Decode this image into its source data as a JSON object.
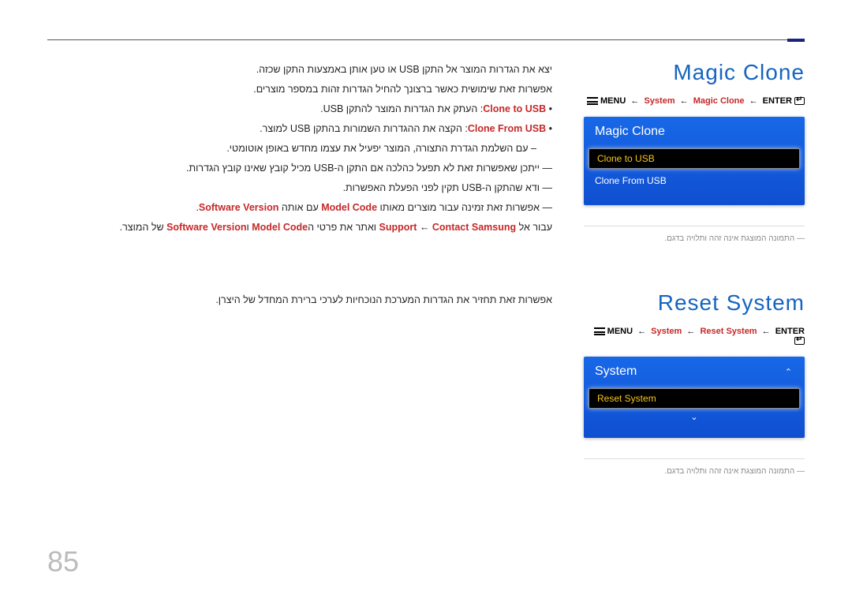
{
  "page_number": "85",
  "magic_clone": {
    "title": "Magic Clone",
    "breadcrumb": {
      "menu": "MENU",
      "lvl1": "System",
      "lvl2": "Magic Clone",
      "enter": "ENTER"
    },
    "osd": {
      "title": "Magic Clone",
      "selected": "Clone to USB",
      "item2": "Clone From USB"
    },
    "caption": "התמונה המוצגת אינה זהה ותלויה בדגם.",
    "body": {
      "p1": "יצא את הגדרות המוצר אל התקן USB או טען אותן באמצעות התקן שכזה.",
      "p2": "אפשרות זאת שימושית כאשר ברצונך להחיל הגדרות זהות במספר מוצרים.",
      "b1_label": "Clone to USB",
      "b1_text": ": העתק את הגדרות המוצר להתקן USB.",
      "b2_label": "Clone From USB",
      "b2_text": ": הקצה את ההגדרות השמורות בהתקן USB למוצר.",
      "sub1": "עם השלמת הגדרת התצורה, המוצר יפעיל את עצמו מחדש באופן אוטומטי.",
      "note1_pre": "ייתכן שאפשרות זאת לא תפעל כהלכה אם התקן ה-USB מכיל קובץ שאינו קובץ הגדרות.",
      "note2_pre": "ודא שהתקן ה-USB תקין לפני הפעלת האפשרות.",
      "note3_pre": "אפשרות זאת זמינה עבור מוצרים מאותו ",
      "note3_mc": "Model Code",
      "note3_mid": " עם אותה ",
      "note3_sv": "Software Version",
      "note3_end": ".",
      "note4_pre": "עבור אל ",
      "note4_support": "Support",
      "note4_arrow": " ← ",
      "note4_contact": "Contact Samsung",
      "note4_mid": " ואתר את פרטי ה",
      "note4_mc": "Model Code",
      "note4_and": " ו",
      "note4_sv": "Software Version",
      "note4_end": " של המוצר."
    }
  },
  "reset_system": {
    "title": "Reset System",
    "breadcrumb": {
      "menu": "MENU",
      "lvl1": "System",
      "lvl2": "Reset System",
      "enter": "ENTER"
    },
    "osd": {
      "title": "System",
      "selected": "Reset System"
    },
    "caption": "התמונה המוצגת אינה זהה ותלויה בדגם.",
    "body": "אפשרות זאת תחזיר את הגדרות המערכת הנוכחיות לערכי ברירת המחדל של היצרן."
  }
}
